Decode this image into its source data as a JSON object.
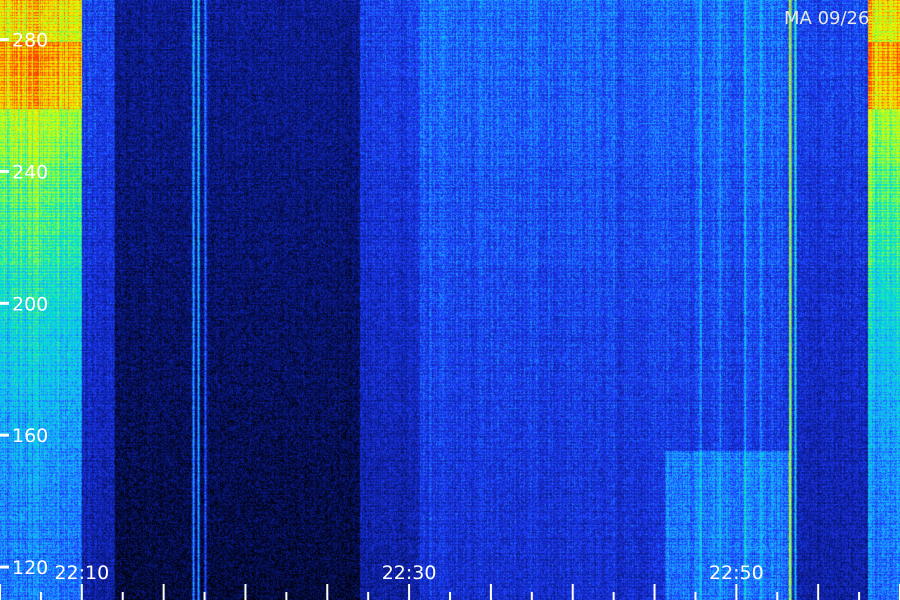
{
  "stamp": "MA 09/26",
  "chart_data": {
    "type": "heatmap",
    "title": "",
    "xlabel": "",
    "ylabel": "",
    "y_ticks": [
      120,
      160,
      200,
      240,
      280
    ],
    "x_ticks": [
      "22:10",
      "22:30",
      "22:50"
    ],
    "x_range": [
      "22:05",
      "23:00"
    ],
    "y_range": [
      110,
      292
    ],
    "colormap": [
      "#000000",
      "#0a1a8c",
      "#1e3cff",
      "#19b4ff",
      "#00e6c8",
      "#8cff3c",
      "#e6ff00",
      "#ffb400",
      "#ff3c00"
    ],
    "bands": [
      {
        "from": "22:05",
        "to": "22:10",
        "note_level": "high"
      },
      {
        "from": "22:12",
        "to": "22:27",
        "note_level": "low"
      },
      {
        "from": "22:58",
        "to": "23:00",
        "note_level": "high"
      }
    ]
  }
}
